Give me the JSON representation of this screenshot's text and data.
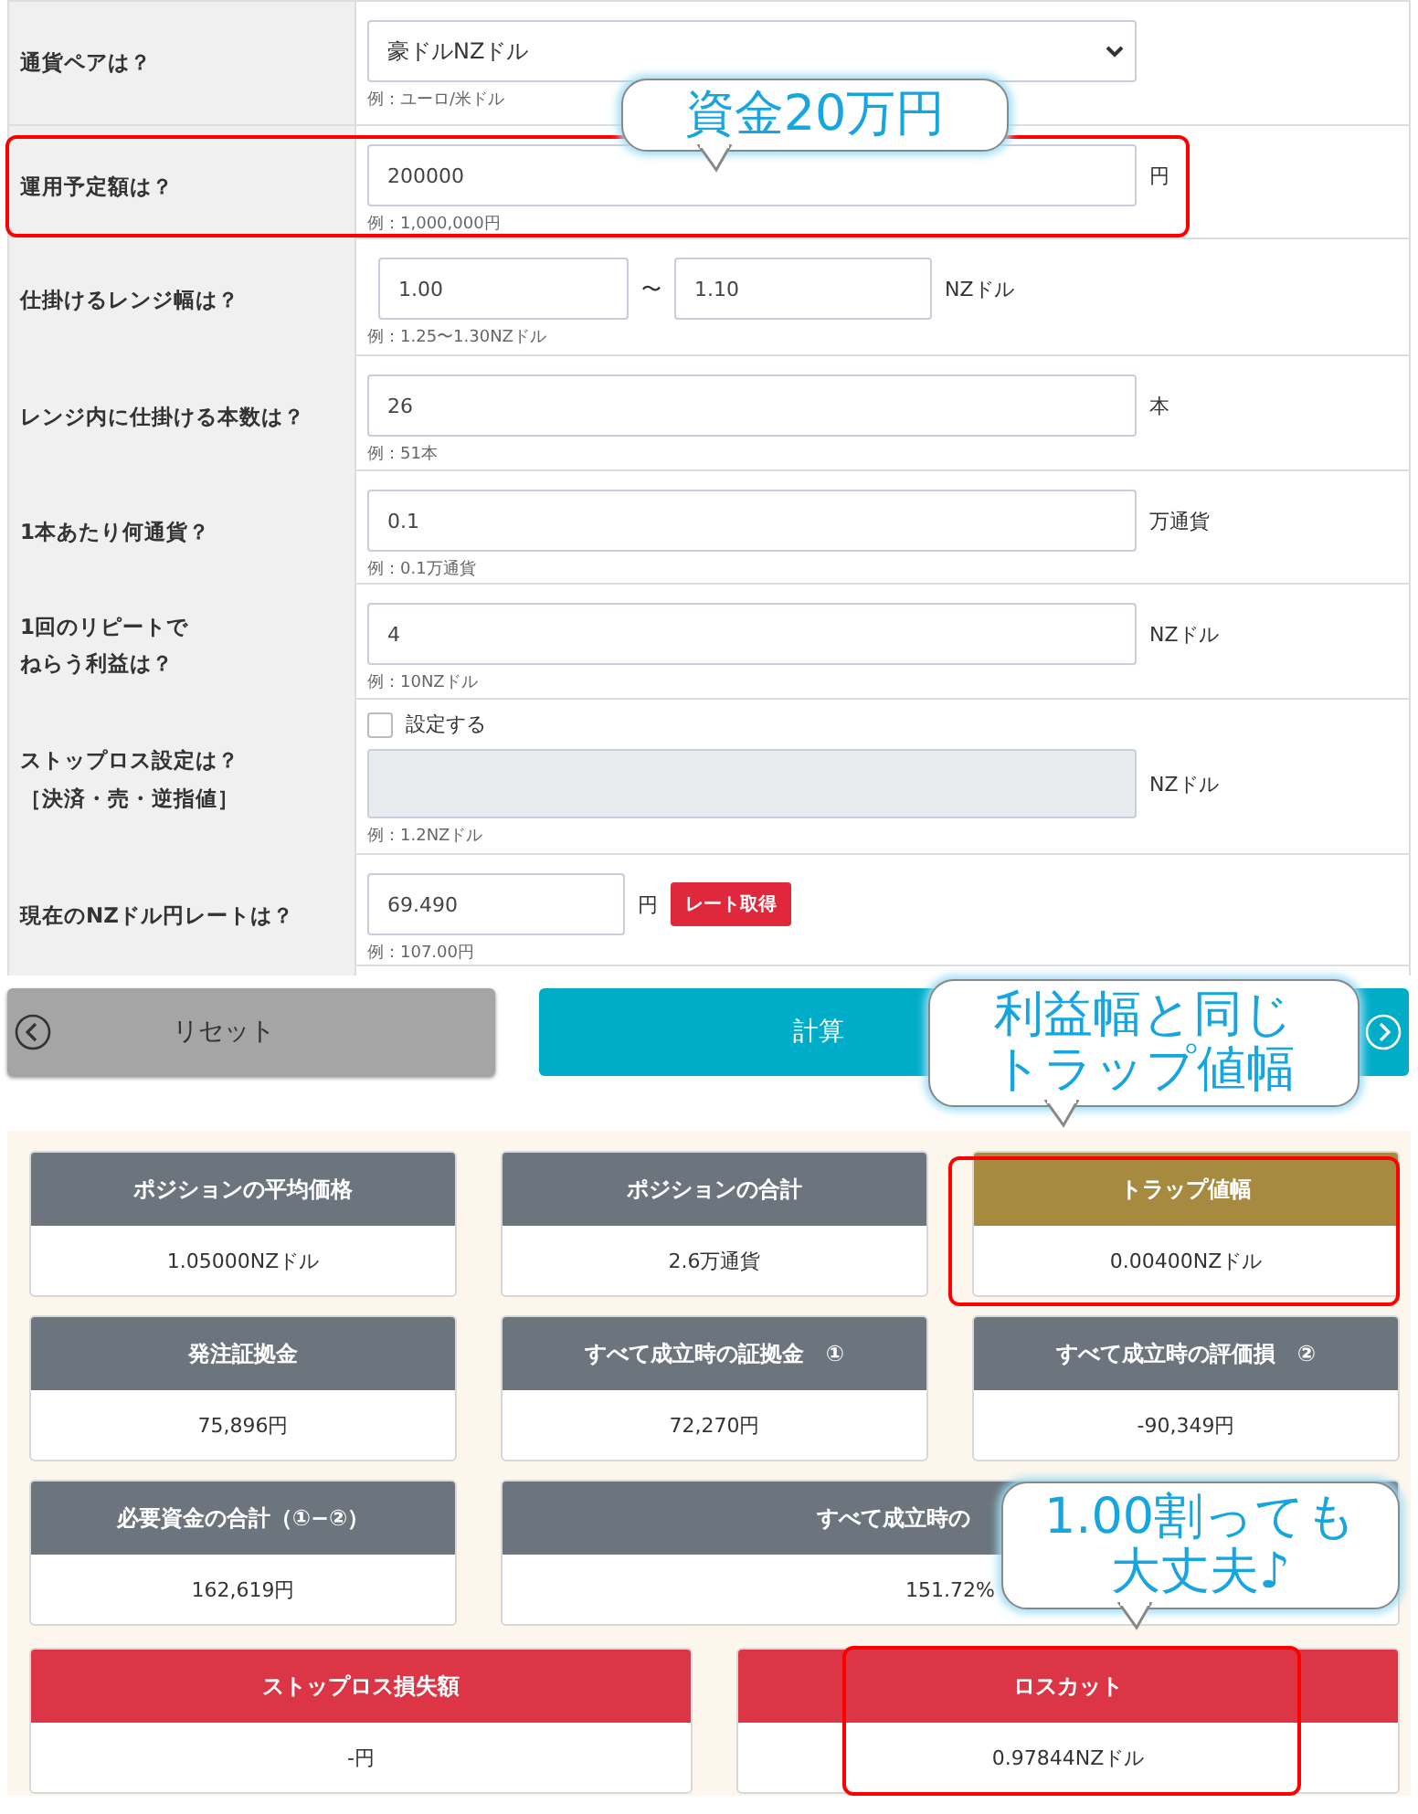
{
  "form": {
    "rows": [
      {
        "kind": "select",
        "label": "通貨ペアは？",
        "value": "豪ドルNZドル",
        "example": "例：ユーロ/米ドル"
      },
      {
        "kind": "input",
        "label": "運用予定額は？",
        "value": "200000",
        "unit": "円",
        "example": "例：1,000,000円"
      },
      {
        "kind": "range",
        "label": "仕掛けるレンジ幅は？",
        "value": "1.00",
        "separator": "〜",
        "value_to": "1.10",
        "unit": "NZドル",
        "example": "例：1.25〜1.30NZドル"
      },
      {
        "kind": "input",
        "label": "レンジ内に仕掛ける本数は？",
        "value": "26",
        "unit": "本",
        "example": "例：51本"
      },
      {
        "kind": "input",
        "label": "1本あたり何通貨？",
        "value": "0.1",
        "unit": "万通貨",
        "example": "例：0.1万通貨"
      },
      {
        "kind": "input",
        "label": [
          "1回のリピートで",
          "ねらう利益は？"
        ],
        "value": "4",
        "unit": "NZドル",
        "example": "例：10NZドル"
      },
      {
        "kind": "checkbox",
        "label": [
          "ストップロス設定は？",
          "［決済・売・逆指値］"
        ],
        "checkbox_label": "設定する",
        "checked": false,
        "disabled": true,
        "unit": "NZドル",
        "example": "例：1.2NZドル"
      },
      {
        "kind": "rate",
        "label": "現在のNZドル円レートは？",
        "value": "69.490",
        "unit": "円",
        "button": "レート取得",
        "example": "例：107.00円"
      }
    ]
  },
  "buttons": [
    {
      "kind": "reset",
      "label": "リセット"
    },
    {
      "kind": "calculate",
      "label": "計算"
    }
  ],
  "results": {
    "rows": [
      [
        {
          "title": "ポジションの平均価格",
          "value": "1.05000NZドル",
          "color": "#6c757d"
        },
        {
          "title": "ポジションの合計",
          "value": "2.6万通貨",
          "color": "#6c757d"
        },
        {
          "title": "トラップ値幅",
          "value": "0.00400NZドル",
          "color": "#a68a40"
        }
      ],
      [
        {
          "title": "発注証拠金",
          "value": "75,896円",
          "color": "#6c757d"
        },
        {
          "title": "すべて成立時の証拠金　①",
          "value": "72,270円",
          "color": "#6c757d"
        },
        {
          "title": "すべて成立時の評価損　②",
          "value": "-90,349円",
          "color": "#6c757d"
        }
      ],
      [
        {
          "title": "必要資金の合計（①−②）",
          "value": "162,619円",
          "color": "#6c757d"
        },
        {
          "title": "すべて成立時の",
          "value": "151.72%",
          "color": "#6c757d",
          "wide": true
        }
      ],
      [
        {
          "title": "ストップロス損失額",
          "value": "-円",
          "color": "#dc3545"
        },
        {
          "title": "ロスカット",
          "value": "0.97844NZドル",
          "color": "#dc3545"
        }
      ]
    ]
  },
  "callouts": [
    {
      "lines": [
        "資金20万円"
      ]
    },
    {
      "lines": [
        "利益幅と同じ",
        "トラップ値幅"
      ]
    },
    {
      "lines": [
        "1.00割っても",
        "大丈夫♪"
      ]
    }
  ]
}
